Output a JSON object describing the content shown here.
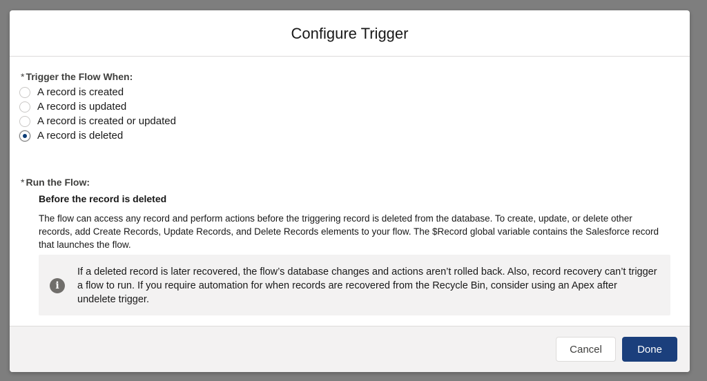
{
  "modal": {
    "title": "Configure Trigger"
  },
  "trigger_field": {
    "required_marker": "*",
    "label": "Trigger the Flow When:",
    "options": [
      {
        "label": "A record is created",
        "checked": false
      },
      {
        "label": "A record is updated",
        "checked": false
      },
      {
        "label": "A record is created or updated",
        "checked": false
      },
      {
        "label": "A record is deleted",
        "checked": true
      }
    ]
  },
  "run_field": {
    "required_marker": "*",
    "label": "Run the Flow:",
    "option_title": "Before the record is deleted",
    "description": "The flow can access any record and perform actions before the triggering record is deleted from the database. To create, update, or delete other records, add Create Records, Update Records, and Delete Records elements to your flow. The $Record global variable contains the Salesforce record that launches the flow."
  },
  "info_box": {
    "icon": "info-icon",
    "text": "If a deleted record is later recovered, the flow’s database changes and actions aren’t rolled back. Also, record recovery can’t trigger a flow to run. If you require automation for when records are recovered from the Recycle Bin, consider using an Apex after undelete trigger."
  },
  "footer": {
    "cancel_label": "Cancel",
    "done_label": "Done"
  },
  "colors": {
    "primary_button": "#1b3f7c",
    "radio_selected": "#0b3b75",
    "overlay": "#7e7e7e"
  }
}
